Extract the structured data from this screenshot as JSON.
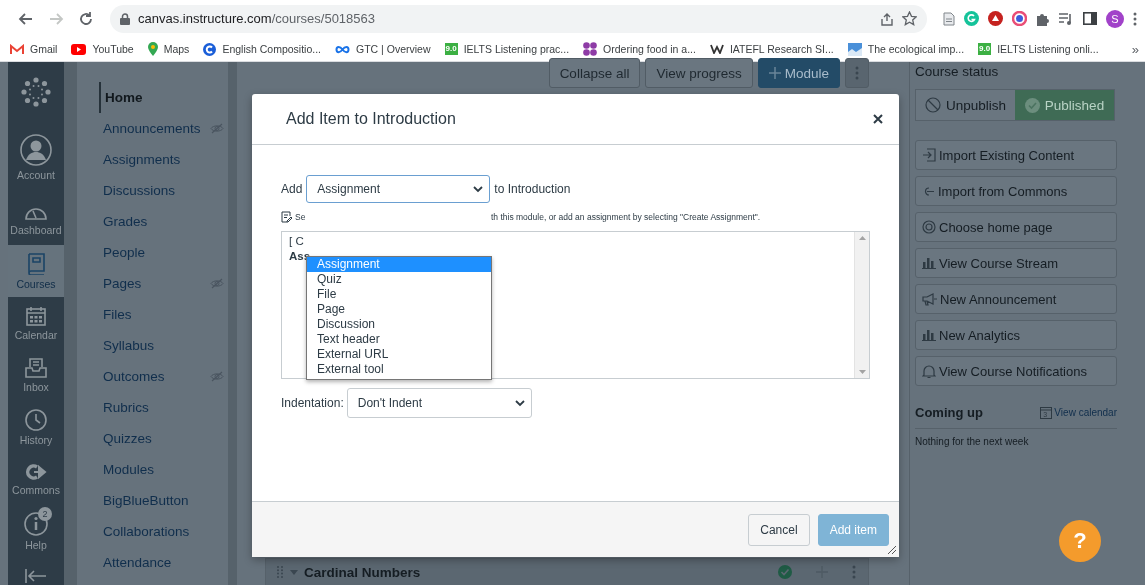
{
  "browser": {
    "nav_buttons": [
      {
        "kind": "back",
        "disabled": false
      },
      {
        "kind": "forward",
        "disabled": true
      },
      {
        "kind": "reload",
        "disabled": false
      }
    ],
    "url": {
      "host": "canvas.instructure.com",
      "path": "/courses/5018563"
    },
    "profile_initial": "S"
  },
  "bookmarks": [
    {
      "label": "Gmail",
      "kind": "mail"
    },
    {
      "label": "YouTube",
      "kind": "video"
    },
    {
      "label": "Maps",
      "kind": "pin"
    },
    {
      "label": "English Compositio...",
      "kind": "ring"
    },
    {
      "label": "GTC | Overview",
      "kind": "infinity"
    },
    {
      "label": "IELTS Listening prac...",
      "kind": "badge",
      "icon_text": "9.0"
    },
    {
      "label": "Ordering food in a...",
      "kind": "dots"
    },
    {
      "label": "IATEFL Research SI...",
      "kind": "wave"
    },
    {
      "label": "The ecological imp...",
      "kind": "picture"
    },
    {
      "label": "IELTS Listening onli...",
      "kind": "badge",
      "icon_text": "9.0"
    }
  ],
  "bookmarks_overflow": "»",
  "global_nav": [
    {
      "label": "Account",
      "kind": "account",
      "selected": false
    },
    {
      "label": "Dashboard",
      "kind": "dashboard",
      "selected": false
    },
    {
      "label": "Courses",
      "kind": "courses",
      "selected": true
    },
    {
      "label": "Calendar",
      "kind": "calendar",
      "selected": false
    },
    {
      "label": "Inbox",
      "kind": "inbox",
      "selected": false
    },
    {
      "label": "History",
      "kind": "history",
      "selected": false
    },
    {
      "label": "Commons",
      "kind": "commons",
      "selected": false
    },
    {
      "label": "Help",
      "kind": "help",
      "selected": false,
      "badge": "2"
    }
  ],
  "course_nav": [
    {
      "label": "Home",
      "selected": true,
      "hidden": false
    },
    {
      "label": "Announcements",
      "selected": false,
      "hidden": true
    },
    {
      "label": "Assignments",
      "selected": false,
      "hidden": false
    },
    {
      "label": "Discussions",
      "selected": false,
      "hidden": false
    },
    {
      "label": "Grades",
      "selected": false,
      "hidden": false
    },
    {
      "label": "People",
      "selected": false,
      "hidden": false
    },
    {
      "label": "Pages",
      "selected": false,
      "hidden": true
    },
    {
      "label": "Files",
      "selected": false,
      "hidden": false
    },
    {
      "label": "Syllabus",
      "selected": false,
      "hidden": false
    },
    {
      "label": "Outcomes",
      "selected": false,
      "hidden": true
    },
    {
      "label": "Rubrics",
      "selected": false,
      "hidden": false
    },
    {
      "label": "Quizzes",
      "selected": false,
      "hidden": false
    },
    {
      "label": "Modules",
      "selected": false,
      "hidden": false
    },
    {
      "label": "BigBlueButton",
      "selected": false,
      "hidden": false
    },
    {
      "label": "Collaborations",
      "selected": false,
      "hidden": false
    },
    {
      "label": "Attendance",
      "selected": false,
      "hidden": false
    }
  ],
  "toolbar": [
    {
      "label": "Collapse all",
      "kind": "default"
    },
    {
      "label": "View progress",
      "kind": "default"
    },
    {
      "label": "Module",
      "kind": "primary"
    }
  ],
  "module_row": {
    "title": "Cardinal Numbers",
    "published": true
  },
  "modal": {
    "title": "Add Item to Introduction",
    "add_label": "Add",
    "type_select": {
      "value": "Assignment",
      "expanded": true,
      "options": [
        {
          "label": "Assignment",
          "selected": true
        },
        {
          "label": "Quiz",
          "selected": false
        },
        {
          "label": "File",
          "selected": false
        },
        {
          "label": "Page",
          "selected": false
        },
        {
          "label": "Discussion",
          "selected": false
        },
        {
          "label": "Text header",
          "selected": false
        },
        {
          "label": "External URL",
          "selected": false
        },
        {
          "label": "External tool",
          "selected": false
        }
      ]
    },
    "target_label": "to Introduction",
    "hint_start": "Se",
    "hint_end": "th this module, or add an assignment by selecting \"Create Assignment\".",
    "list_fragments": [
      {
        "text": "[ C",
        "kind": "plain"
      },
      {
        "text": "Ass",
        "kind": "bold"
      }
    ],
    "indent_label": "Indentation:",
    "indent_value": "Don't Indent",
    "buttons": [
      {
        "label": "Cancel",
        "kind": "secondary",
        "disabled": false
      },
      {
        "label": "Add item",
        "kind": "primary",
        "disabled": true
      }
    ]
  },
  "sidebar": {
    "status_title": "Course status",
    "status_buttons": [
      {
        "label": "Unpublish",
        "kind": "ban",
        "selected": false
      },
      {
        "label": "Published",
        "kind": "check",
        "selected": true
      }
    ],
    "actions": [
      {
        "label": "Import Existing Content",
        "kind": "import"
      },
      {
        "label": "Import from Commons",
        "kind": "commons"
      },
      {
        "label": "Choose home page",
        "kind": "target"
      },
      {
        "label": "View Course Stream",
        "kind": "bars"
      },
      {
        "label": "New Announcement",
        "kind": "megaphone"
      },
      {
        "label": "New Analytics",
        "kind": "bars"
      },
      {
        "label": "View Course Notifications",
        "kind": "bell"
      }
    ],
    "coming_up_title": "Coming up",
    "calendar_day": "3",
    "calendar_link": "View calendar",
    "empty_text": "Nothing for the next week"
  },
  "help_fab": {
    "label": "?"
  }
}
